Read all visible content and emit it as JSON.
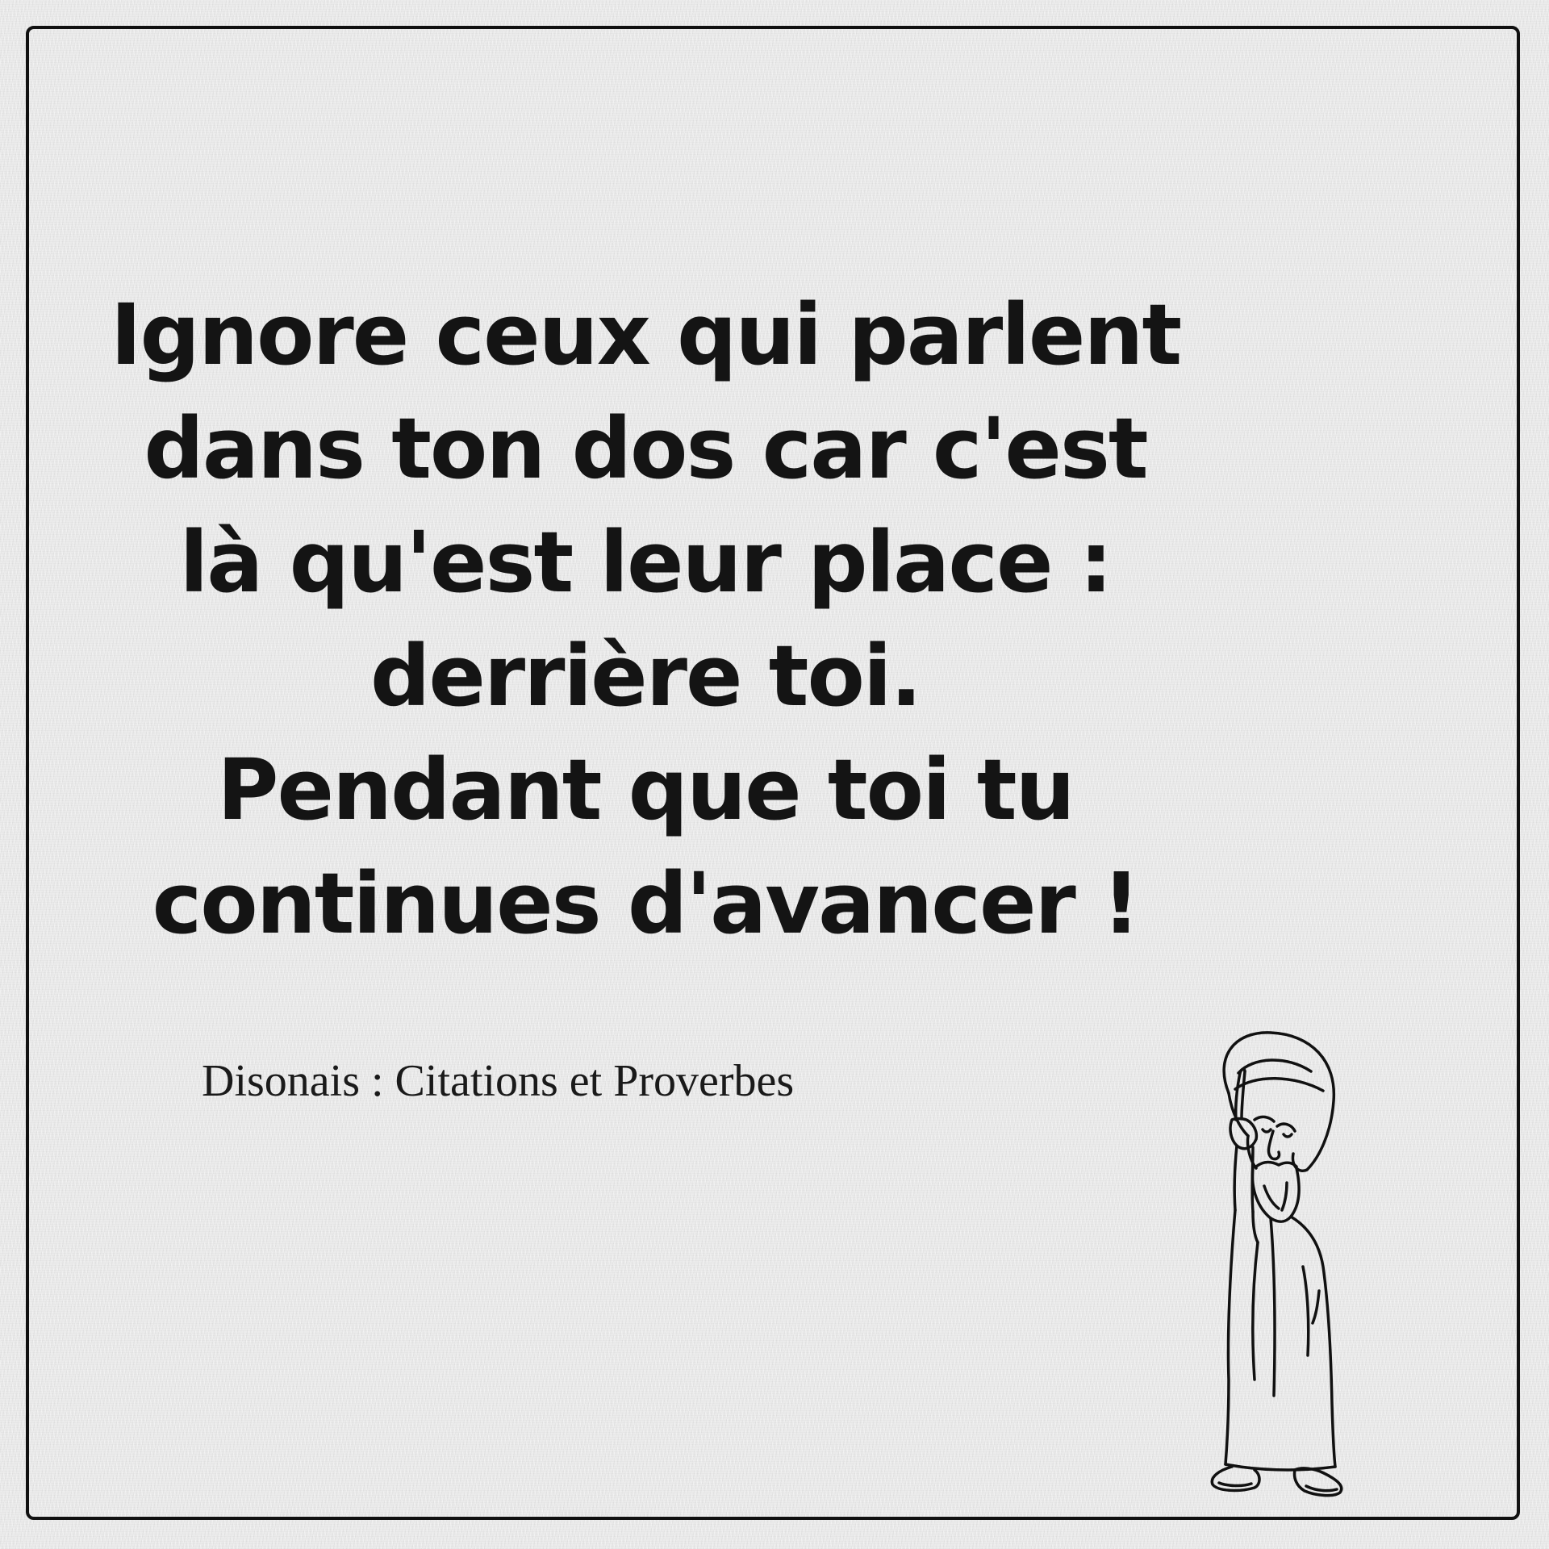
{
  "quote": {
    "lines": [
      "Ignore ceux qui parlent",
      "dans ton dos car c'est",
      "là qu'est leur place :",
      "derrière toi.",
      "Pendant que toi tu",
      "continues d'avancer !"
    ]
  },
  "attribution": "Disonais : Citations et Proverbes",
  "illustration": {
    "icon": "sage-pointing-finger-icon",
    "stroke_color": "#111111"
  },
  "colors": {
    "background": "#ebebeb",
    "text": "#141414",
    "frame": "#111111"
  }
}
